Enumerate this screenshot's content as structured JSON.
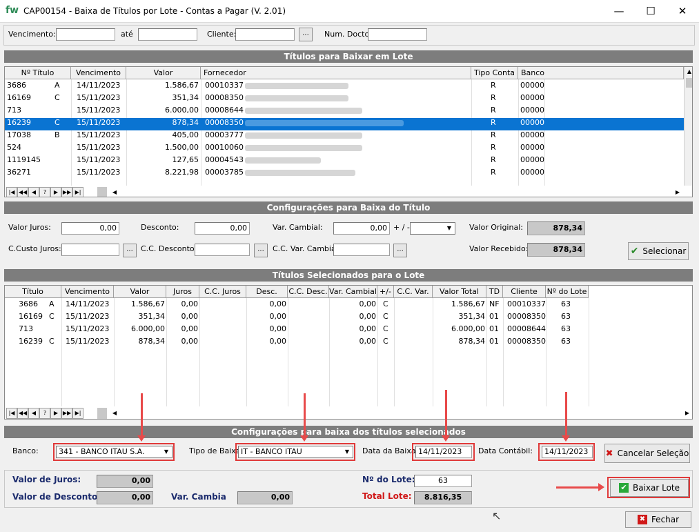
{
  "window": {
    "title": "CAP00154 - Baixa de Títulos por Lote - Contas a Pagar   (V. 2.01)",
    "logo": "fw",
    "minimize": "—",
    "maximize": "☐",
    "close": "✕"
  },
  "filter": {
    "vencimento_label": "Vencimento:",
    "ate_label": "até",
    "cliente_label": "Cliente:",
    "num_docto_label": "Num. Docto",
    "dots": "..."
  },
  "titles_section": {
    "header": "Títulos para Baixar em Lote",
    "columns": [
      "Nº Título",
      "Vencimento",
      "Valor",
      "Fornecedor",
      "Tipo Conta",
      "Banco"
    ],
    "rows": [
      {
        "num": "3686",
        "suf": "A",
        "venc": "14/11/2023",
        "valor": "1.586,67",
        "forn": "00010337",
        "tipo": "R",
        "banco": "00000"
      },
      {
        "num": "16169",
        "suf": "C",
        "venc": "15/11/2023",
        "valor": "351,34",
        "forn": "00008350",
        "tipo": "R",
        "banco": "00000"
      },
      {
        "num": "713",
        "suf": "",
        "venc": "15/11/2023",
        "valor": "6.000,00",
        "forn": "00008644",
        "tipo": "R",
        "banco": "00000"
      },
      {
        "num": "16239",
        "suf": "C",
        "venc": "15/11/2023",
        "valor": "878,34",
        "forn": "00008350",
        "tipo": "R",
        "banco": "00000"
      },
      {
        "num": "17038",
        "suf": "B",
        "venc": "15/11/2023",
        "valor": "405,00",
        "forn": "00003777",
        "tipo": "R",
        "banco": "00000"
      },
      {
        "num": "524",
        "suf": "",
        "venc": "15/11/2023",
        "valor": "1.500,00",
        "forn": "00010060",
        "tipo": "R",
        "banco": "00000"
      },
      {
        "num": "1119145",
        "suf": "",
        "venc": "15/11/2023",
        "valor": "127,65",
        "forn": "00004543",
        "tipo": "R",
        "banco": "00000"
      },
      {
        "num": "36271",
        "suf": "",
        "venc": "15/11/2023",
        "valor": "8.221,98",
        "forn": "00003785",
        "tipo": "R",
        "banco": "00000"
      }
    ]
  },
  "nav": [
    "|◀",
    "◀◀",
    "◀",
    "?",
    "▶",
    "▶▶",
    "▶|"
  ],
  "config": {
    "header": "Configurações para Baixa do Título",
    "valor_juros_label": "Valor Juros:",
    "valor_juros": "0,00",
    "desconto_label": "Desconto:",
    "desconto": "0,00",
    "var_cambial_label": "Var. Cambial:",
    "var_cambial": "0,00",
    "sign_label": "+ / -",
    "valor_original_label": "Valor Original:",
    "valor_original": "878,34",
    "cc_juros_label": "C.Custo Juros:",
    "cc_desconto_label": "C.C. Desconto:",
    "cc_var_label": "C.C. Var. Cambial:",
    "valor_recebido_label": "Valor Recebido:",
    "valor_recebido": "878,34",
    "selecionar": "Selecionar"
  },
  "selected": {
    "header": "Títulos Selecionados para o Lote",
    "columns": [
      "Título",
      "Vencimento",
      "Valor",
      "Juros",
      "C.C. Juros",
      "Desc.",
      "C.C. Desc.",
      "Var. Cambial",
      "+/-",
      "C.C. Var.",
      "Valor Total",
      "TD",
      "Cliente",
      "Nº do Lote"
    ],
    "rows": [
      {
        "num": "3686",
        "suf": "A",
        "venc": "14/11/2023",
        "valor": "1.586,67",
        "juros": "0,00",
        "desc": "0,00",
        "var": "0,00",
        "sign": "C",
        "total": "1.586,67",
        "td": "NF",
        "cliente": "00010337",
        "lote": "63"
      },
      {
        "num": "16169",
        "suf": "C",
        "venc": "15/11/2023",
        "valor": "351,34",
        "juros": "0,00",
        "desc": "0,00",
        "var": "0,00",
        "sign": "C",
        "total": "351,34",
        "td": "01",
        "cliente": "00008350",
        "lote": "63"
      },
      {
        "num": "713",
        "suf": "",
        "venc": "15/11/2023",
        "valor": "6.000,00",
        "juros": "0,00",
        "desc": "0,00",
        "var": "0,00",
        "sign": "C",
        "total": "6.000,00",
        "td": "01",
        "cliente": "00008644",
        "lote": "63"
      },
      {
        "num": "16239",
        "suf": "C",
        "venc": "15/11/2023",
        "valor": "878,34",
        "juros": "0,00",
        "desc": "0,00",
        "var": "0,00",
        "sign": "C",
        "total": "878,34",
        "td": "01",
        "cliente": "00008350",
        "lote": "63"
      }
    ]
  },
  "batch": {
    "header": "Configurações para baixa dos títulos selecionados",
    "banco_label": "Banco:",
    "banco": "341 - BANCO ITAU S.A.",
    "tipo_baixa_label": "Tipo de Baixa:",
    "tipo_baixa": "IT - BANCO ITAU",
    "data_baixa_label": "Data da Baixa:",
    "data_baixa": "14/11/2023",
    "data_contabil_label": "Data Contábil:",
    "data_contabil": "14/11/2023",
    "cancelar": "Cancelar Seleção"
  },
  "summary": {
    "valor_juros_label": "Valor de Juros:",
    "valor_juros": "0,00",
    "valor_desconto_label": "Valor de Desconto:",
    "valor_desconto": "0,00",
    "var_cambia_label": "Var. Cambia",
    "var_cambia": "0,00",
    "num_lote_label": "Nº do Lote:",
    "num_lote": "63",
    "total_lote_label": "Total Lote:",
    "total_lote": "8.816,35",
    "baixar_lote": "Baixar Lote",
    "fechar": "Fechar"
  },
  "colors": {
    "selection": "#0a74d2",
    "section": "#7d7d7d",
    "annotation": "#e03a3a",
    "total_label": "#d01818",
    "label_blue": "#1a2a6c"
  }
}
